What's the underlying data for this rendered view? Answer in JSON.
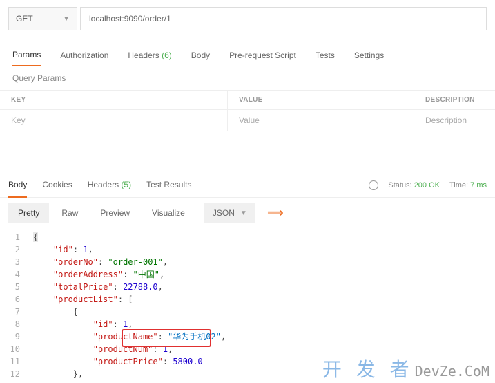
{
  "request": {
    "method": "GET",
    "url": "localhost:9090/order/1"
  },
  "tabs": {
    "params": "Params",
    "authorization": "Authorization",
    "headers": "Headers",
    "headers_count": "(6)",
    "body": "Body",
    "prerequest": "Pre-request Script",
    "tests": "Tests",
    "settings": "Settings"
  },
  "sub": {
    "query_params": "Query Params"
  },
  "param_headers": {
    "key": "KEY",
    "value": "VALUE",
    "desc": "DESCRIPTION"
  },
  "param_placeholders": {
    "key": "Key",
    "value": "Value",
    "desc": "Description"
  },
  "resp_tabs": {
    "body": "Body",
    "cookies": "Cookies",
    "headers": "Headers",
    "headers_count": "(5)",
    "tests": "Test Results"
  },
  "status": {
    "status_label": "Status:",
    "status_value": "200 OK",
    "time_label": "Time:",
    "time_value": "7 ms"
  },
  "view": {
    "pretty": "Pretty",
    "raw": "Raw",
    "preview": "Preview",
    "visualize": "Visualize",
    "format": "JSON"
  },
  "code": {
    "l1": "{",
    "l2_k": "\"id\"",
    "l2_v": "1",
    "l3_k": "\"orderNo\"",
    "l3_v": "\"order-001\"",
    "l4_k": "\"orderAddress\"",
    "l4_v": "\"中国\"",
    "l5_k": "\"totalPrice\"",
    "l5_v": "22788.0",
    "l6_k": "\"productList\"",
    "l8_k": "\"id\"",
    "l8_v": "1",
    "l9_k": "\"productName\"",
    "l9_v": "\"华为手机02\"",
    "l10_k": "\"productNum\"",
    "l10_v": "1",
    "l11_k": "\"productPrice\"",
    "l11_v": "5800.0"
  },
  "watermark": {
    "cn": "开 发 者",
    "en": "DevZe.CoM"
  }
}
